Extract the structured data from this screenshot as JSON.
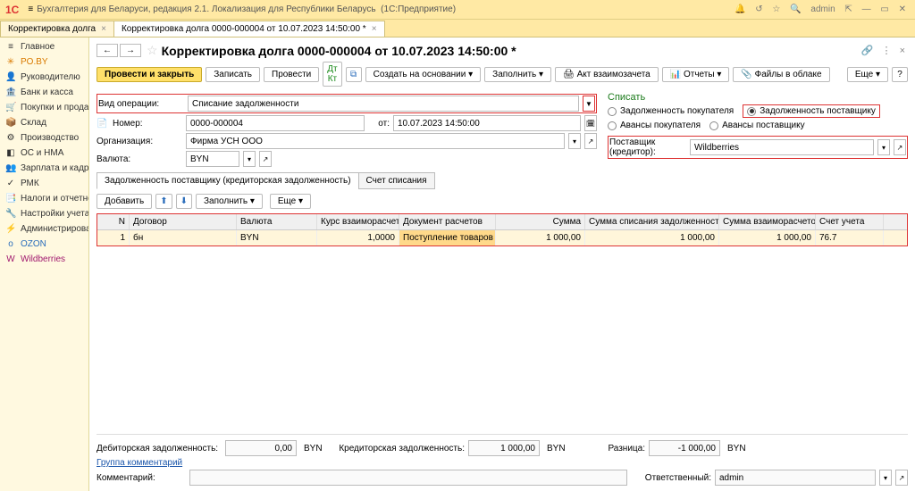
{
  "app": {
    "title": "Бухгалтерия для Беларуси, редакция 2.1. Локализация для Республики Беларусь",
    "platform": "(1С:Предприятие)",
    "user": "admin"
  },
  "tabs": {
    "t1": "Корректировка долга",
    "t2": "Корректировка долга 0000-000004 от 10.07.2023 14:50:00 *"
  },
  "sidebar": {
    "items": [
      {
        "icon": "≡",
        "label": "Главное"
      },
      {
        "icon": "✳",
        "label": "PO.BY",
        "color": "#d97a00"
      },
      {
        "icon": "👤",
        "label": "Руководителю"
      },
      {
        "icon": "🏦",
        "label": "Банк и касса"
      },
      {
        "icon": "🛒",
        "label": "Покупки и продажи"
      },
      {
        "icon": "📦",
        "label": "Склад"
      },
      {
        "icon": "⚙",
        "label": "Производство"
      },
      {
        "icon": "◧",
        "label": "ОС и НМА"
      },
      {
        "icon": "👥",
        "label": "Зарплата и кадры"
      },
      {
        "icon": "✓",
        "label": "РМК"
      },
      {
        "icon": "📑",
        "label": "Налоги и отчетность"
      },
      {
        "icon": "🔧",
        "label": "Настройки учета"
      },
      {
        "icon": "⚡",
        "label": "Администрирование"
      },
      {
        "icon": "o",
        "label": "OZON",
        "color": "#2a6dbb"
      },
      {
        "icon": "W",
        "label": "Wildberries",
        "color": "#a0186e"
      }
    ]
  },
  "doc": {
    "title": "Корректировка долга 0000-000004 от 10.07.2023 14:50:00 *",
    "toolbar": {
      "post_close": "Провести и закрыть",
      "write": "Записать",
      "post": "Провести",
      "create_based": "Создать на основании",
      "fill": "Заполнить",
      "offset_act": "Акт взаимозачета",
      "reports": "Отчеты",
      "cloud_files": "Файлы в облаке",
      "more": "Еще"
    },
    "fields": {
      "optype_label": "Вид операции:",
      "optype_value": "Списание задолженности",
      "number_icon": "📄",
      "number_label": "Номер:",
      "number_value": "0000-000004",
      "date_label": "от:",
      "date_value": "10.07.2023 14:50:00",
      "org_label": "Организация:",
      "org_value": "Фирма УСН ООО",
      "currency_label": "Валюта:",
      "currency_value": "BYN",
      "writeoff_legend": "Списать",
      "r_buyer_debt": "Задолженность покупателя",
      "r_supplier_debt": "Задолженность поставщику",
      "r_buyer_adv": "Авансы покупателя",
      "r_supplier_adv": "Авансы поставщику",
      "supplier_label": "Поставщик (кредитор):",
      "supplier_value": "Wildberries"
    },
    "section_tabs": {
      "t1": "Задолженность поставщику (кредиторская задолженность)",
      "t2": "Счет списания"
    },
    "subtoolbar": {
      "add": "Добавить",
      "fill": "Заполнить",
      "more": "Еще"
    },
    "grid": {
      "headers": {
        "n": "N",
        "dog": "Договор",
        "val": "Валюта",
        "kurs": "Курс взаиморасчетов",
        "doc": "Документ расчетов",
        "sum": "Сумма",
        "nu": "Сумма списания задолженности (НУ)",
        "vz": "Сумма взаиморасчетов",
        "su": "Счет учета"
      },
      "row": {
        "n": "1",
        "dog": "бн",
        "val": "BYN",
        "kurs": "1,0000",
        "doc": "Поступление товаров и у...",
        "sum": "1 000,00",
        "nu": "1 000,00",
        "vz": "1 000,00",
        "su": "76.7"
      }
    },
    "footer": {
      "debit_label": "Дебиторская задолженность:",
      "debit_value": "0,00",
      "debit_cur": "BYN",
      "credit_label": "Кредиторская задолженность:",
      "credit_value": "1 000,00",
      "credit_cur": "BYN",
      "diff_label": "Разница:",
      "diff_value": "-1 000,00",
      "diff_cur": "BYN",
      "group_comment": "Группа комментарий",
      "comment_label": "Комментарий:",
      "resp_label": "Ответственный:",
      "resp_value": "admin"
    }
  }
}
